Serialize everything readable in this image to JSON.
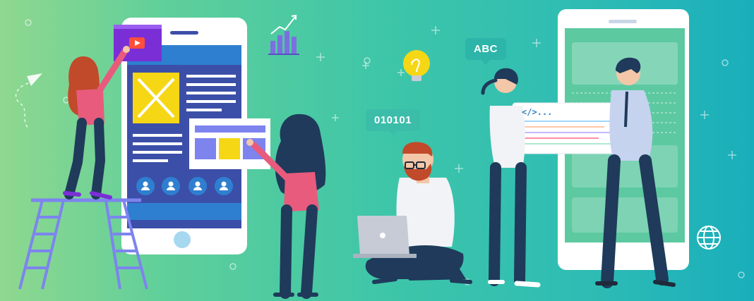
{
  "bubbles": {
    "binary": "010101",
    "abc": "ABC"
  },
  "code_card": {
    "tag": "</>..."
  },
  "icons": [
    "bar-chart-icon",
    "lightbulb-icon",
    "paper-plane-icon",
    "globe-icon",
    "play-icon",
    "user-icon"
  ],
  "colors": {
    "background_left": "#8fd88f",
    "background_right": "#19aebb",
    "phone_screen": "#3c4fa8",
    "accent_yellow": "#f5d716",
    "accent_pink": "#e85b7d",
    "navy": "#1f3a5a"
  }
}
